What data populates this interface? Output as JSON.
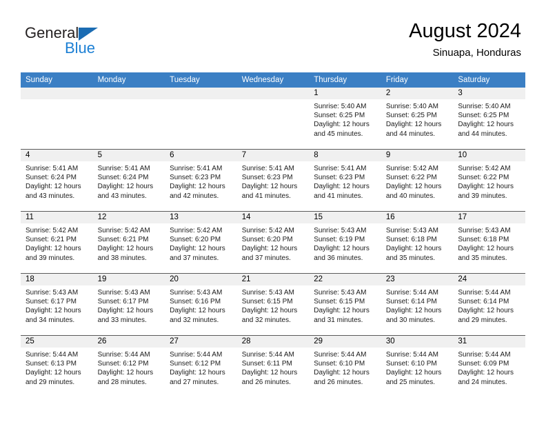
{
  "logo": {
    "word1": "General",
    "word2": "Blue",
    "triangle_color": "#1b6cb3",
    "blue_color": "#1b7fd4"
  },
  "header": {
    "title": "August 2024",
    "subtitle": "Sinuapa, Honduras",
    "header_bg": "#3b7fc4",
    "date_band_bg": "#f0f0f0"
  },
  "weekdays": [
    "Sunday",
    "Monday",
    "Tuesday",
    "Wednesday",
    "Thursday",
    "Friday",
    "Saturday"
  ],
  "weeks": [
    [
      {
        "date": "",
        "empty": true
      },
      {
        "date": "",
        "empty": true
      },
      {
        "date": "",
        "empty": true
      },
      {
        "date": "",
        "empty": true
      },
      {
        "date": "1",
        "sunrise": "Sunrise: 5:40 AM",
        "sunset": "Sunset: 6:25 PM",
        "daylight_1": "Daylight: 12 hours",
        "daylight_2": "and 45 minutes."
      },
      {
        "date": "2",
        "sunrise": "Sunrise: 5:40 AM",
        "sunset": "Sunset: 6:25 PM",
        "daylight_1": "Daylight: 12 hours",
        "daylight_2": "and 44 minutes."
      },
      {
        "date": "3",
        "sunrise": "Sunrise: 5:40 AM",
        "sunset": "Sunset: 6:25 PM",
        "daylight_1": "Daylight: 12 hours",
        "daylight_2": "and 44 minutes."
      }
    ],
    [
      {
        "date": "4",
        "sunrise": "Sunrise: 5:41 AM",
        "sunset": "Sunset: 6:24 PM",
        "daylight_1": "Daylight: 12 hours",
        "daylight_2": "and 43 minutes."
      },
      {
        "date": "5",
        "sunrise": "Sunrise: 5:41 AM",
        "sunset": "Sunset: 6:24 PM",
        "daylight_1": "Daylight: 12 hours",
        "daylight_2": "and 43 minutes."
      },
      {
        "date": "6",
        "sunrise": "Sunrise: 5:41 AM",
        "sunset": "Sunset: 6:23 PM",
        "daylight_1": "Daylight: 12 hours",
        "daylight_2": "and 42 minutes."
      },
      {
        "date": "7",
        "sunrise": "Sunrise: 5:41 AM",
        "sunset": "Sunset: 6:23 PM",
        "daylight_1": "Daylight: 12 hours",
        "daylight_2": "and 41 minutes."
      },
      {
        "date": "8",
        "sunrise": "Sunrise: 5:41 AM",
        "sunset": "Sunset: 6:23 PM",
        "daylight_1": "Daylight: 12 hours",
        "daylight_2": "and 41 minutes."
      },
      {
        "date": "9",
        "sunrise": "Sunrise: 5:42 AM",
        "sunset": "Sunset: 6:22 PM",
        "daylight_1": "Daylight: 12 hours",
        "daylight_2": "and 40 minutes."
      },
      {
        "date": "10",
        "sunrise": "Sunrise: 5:42 AM",
        "sunset": "Sunset: 6:22 PM",
        "daylight_1": "Daylight: 12 hours",
        "daylight_2": "and 39 minutes."
      }
    ],
    [
      {
        "date": "11",
        "sunrise": "Sunrise: 5:42 AM",
        "sunset": "Sunset: 6:21 PM",
        "daylight_1": "Daylight: 12 hours",
        "daylight_2": "and 39 minutes."
      },
      {
        "date": "12",
        "sunrise": "Sunrise: 5:42 AM",
        "sunset": "Sunset: 6:21 PM",
        "daylight_1": "Daylight: 12 hours",
        "daylight_2": "and 38 minutes."
      },
      {
        "date": "13",
        "sunrise": "Sunrise: 5:42 AM",
        "sunset": "Sunset: 6:20 PM",
        "daylight_1": "Daylight: 12 hours",
        "daylight_2": "and 37 minutes."
      },
      {
        "date": "14",
        "sunrise": "Sunrise: 5:42 AM",
        "sunset": "Sunset: 6:20 PM",
        "daylight_1": "Daylight: 12 hours",
        "daylight_2": "and 37 minutes."
      },
      {
        "date": "15",
        "sunrise": "Sunrise: 5:43 AM",
        "sunset": "Sunset: 6:19 PM",
        "daylight_1": "Daylight: 12 hours",
        "daylight_2": "and 36 minutes."
      },
      {
        "date": "16",
        "sunrise": "Sunrise: 5:43 AM",
        "sunset": "Sunset: 6:18 PM",
        "daylight_1": "Daylight: 12 hours",
        "daylight_2": "and 35 minutes."
      },
      {
        "date": "17",
        "sunrise": "Sunrise: 5:43 AM",
        "sunset": "Sunset: 6:18 PM",
        "daylight_1": "Daylight: 12 hours",
        "daylight_2": "and 35 minutes."
      }
    ],
    [
      {
        "date": "18",
        "sunrise": "Sunrise: 5:43 AM",
        "sunset": "Sunset: 6:17 PM",
        "daylight_1": "Daylight: 12 hours",
        "daylight_2": "and 34 minutes."
      },
      {
        "date": "19",
        "sunrise": "Sunrise: 5:43 AM",
        "sunset": "Sunset: 6:17 PM",
        "daylight_1": "Daylight: 12 hours",
        "daylight_2": "and 33 minutes."
      },
      {
        "date": "20",
        "sunrise": "Sunrise: 5:43 AM",
        "sunset": "Sunset: 6:16 PM",
        "daylight_1": "Daylight: 12 hours",
        "daylight_2": "and 32 minutes."
      },
      {
        "date": "21",
        "sunrise": "Sunrise: 5:43 AM",
        "sunset": "Sunset: 6:15 PM",
        "daylight_1": "Daylight: 12 hours",
        "daylight_2": "and 32 minutes."
      },
      {
        "date": "22",
        "sunrise": "Sunrise: 5:43 AM",
        "sunset": "Sunset: 6:15 PM",
        "daylight_1": "Daylight: 12 hours",
        "daylight_2": "and 31 minutes."
      },
      {
        "date": "23",
        "sunrise": "Sunrise: 5:44 AM",
        "sunset": "Sunset: 6:14 PM",
        "daylight_1": "Daylight: 12 hours",
        "daylight_2": "and 30 minutes."
      },
      {
        "date": "24",
        "sunrise": "Sunrise: 5:44 AM",
        "sunset": "Sunset: 6:14 PM",
        "daylight_1": "Daylight: 12 hours",
        "daylight_2": "and 29 minutes."
      }
    ],
    [
      {
        "date": "25",
        "sunrise": "Sunrise: 5:44 AM",
        "sunset": "Sunset: 6:13 PM",
        "daylight_1": "Daylight: 12 hours",
        "daylight_2": "and 29 minutes."
      },
      {
        "date": "26",
        "sunrise": "Sunrise: 5:44 AM",
        "sunset": "Sunset: 6:12 PM",
        "daylight_1": "Daylight: 12 hours",
        "daylight_2": "and 28 minutes."
      },
      {
        "date": "27",
        "sunrise": "Sunrise: 5:44 AM",
        "sunset": "Sunset: 6:12 PM",
        "daylight_1": "Daylight: 12 hours",
        "daylight_2": "and 27 minutes."
      },
      {
        "date": "28",
        "sunrise": "Sunrise: 5:44 AM",
        "sunset": "Sunset: 6:11 PM",
        "daylight_1": "Daylight: 12 hours",
        "daylight_2": "and 26 minutes."
      },
      {
        "date": "29",
        "sunrise": "Sunrise: 5:44 AM",
        "sunset": "Sunset: 6:10 PM",
        "daylight_1": "Daylight: 12 hours",
        "daylight_2": "and 26 minutes."
      },
      {
        "date": "30",
        "sunrise": "Sunrise: 5:44 AM",
        "sunset": "Sunset: 6:10 PM",
        "daylight_1": "Daylight: 12 hours",
        "daylight_2": "and 25 minutes."
      },
      {
        "date": "31",
        "sunrise": "Sunrise: 5:44 AM",
        "sunset": "Sunset: 6:09 PM",
        "daylight_1": "Daylight: 12 hours",
        "daylight_2": "and 24 minutes."
      }
    ]
  ]
}
